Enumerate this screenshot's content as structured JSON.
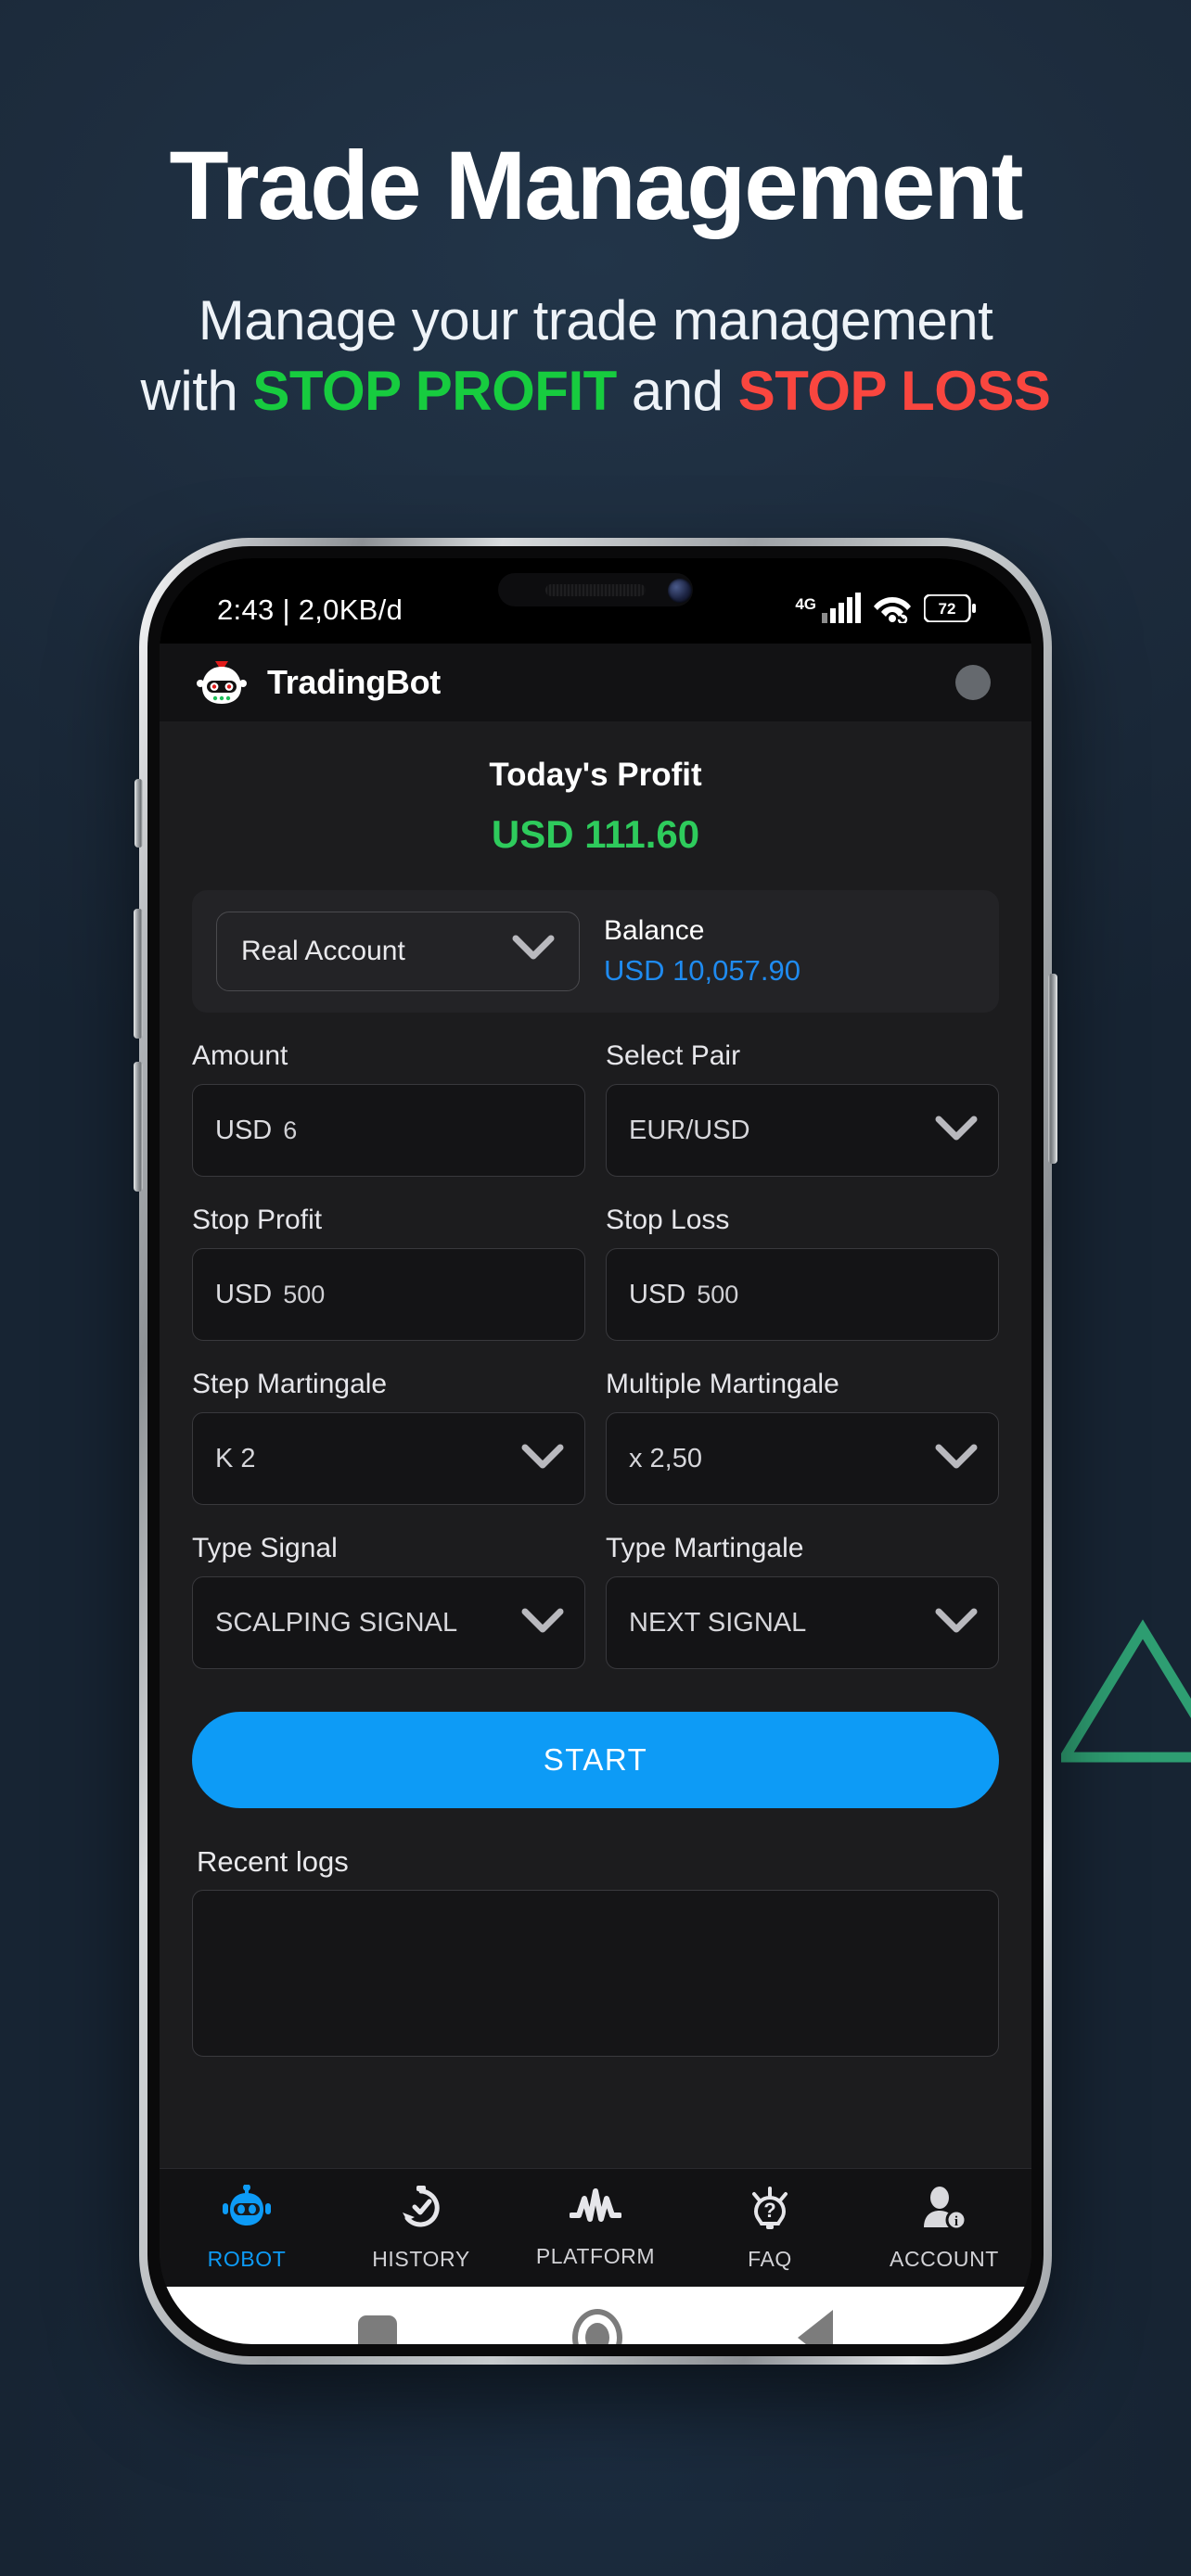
{
  "promo": {
    "title": "Trade Management",
    "subtitle_line1": "Manage your trade management",
    "subtitle_line2_pre": "with ",
    "subtitle_green": "STOP PROFIT",
    "subtitle_mid": " and ",
    "subtitle_red": "STOP LOSS",
    "colors": {
      "green": "#17cc3f",
      "red": "#f9463f",
      "background": "#1b2a3a",
      "deco_triangle": "#2e9e72"
    }
  },
  "status_bar": {
    "time_and_data": "2:43 | 2,0KB/d",
    "network_type": "4G",
    "signal_icon": "signal-bars-icon",
    "wifi_icon": "wifi-icon",
    "battery_level": "72"
  },
  "app_header": {
    "logo_icon": "robot-head-icon",
    "title": "TradingBot",
    "avatar_icon": "avatar-icon"
  },
  "profit": {
    "label": "Today's Profit",
    "value": "USD 111.60",
    "color": "#2ecb5c"
  },
  "account_card": {
    "account_type": "Real Account",
    "account_chevron": "chevron-down-icon",
    "balance_label": "Balance",
    "balance_value": "USD 10,057.90",
    "balance_color": "#1f8bf0"
  },
  "form": {
    "amount": {
      "label": "Amount",
      "unit": "USD",
      "value": "6"
    },
    "select_pair": {
      "label": "Select Pair",
      "value": "EUR/USD",
      "chevron": "chevron-down-icon"
    },
    "stop_profit": {
      "label": "Stop Profit",
      "unit": "USD",
      "value": "500"
    },
    "stop_loss": {
      "label": "Stop Loss",
      "unit": "USD",
      "value": "500"
    },
    "step_martingale": {
      "label": "Step Martingale",
      "value": "K 2",
      "chevron": "chevron-down-icon"
    },
    "multiple_martingale": {
      "label": "Multiple Martingale",
      "value": "x 2,50",
      "chevron": "chevron-down-icon"
    },
    "type_signal": {
      "label": "Type Signal",
      "value": "SCALPING SIGNAL",
      "chevron": "chevron-down-icon"
    },
    "type_martingale": {
      "label": "Type Martingale",
      "value": "NEXT SIGNAL",
      "chevron": "chevron-down-icon"
    }
  },
  "start_button": {
    "label": "START",
    "color": "#0d9bf6"
  },
  "logs": {
    "label": "Recent logs",
    "content": ""
  },
  "bottom_nav": {
    "items": [
      {
        "label": "ROBOT",
        "icon": "robot-icon",
        "active": true
      },
      {
        "label": "HISTORY",
        "icon": "history-clock-icon",
        "active": false
      },
      {
        "label": "PLATFORM",
        "icon": "chart-wave-icon",
        "active": false
      },
      {
        "label": "FAQ",
        "icon": "lightbulb-question-icon",
        "active": false
      },
      {
        "label": "ACCOUNT",
        "icon": "person-info-icon",
        "active": false
      }
    ],
    "active_color": "#0d9bf6"
  },
  "android_nav": {
    "recents_icon": "square-recents-icon",
    "home_icon": "circle-home-icon",
    "back_icon": "triangle-back-icon"
  }
}
